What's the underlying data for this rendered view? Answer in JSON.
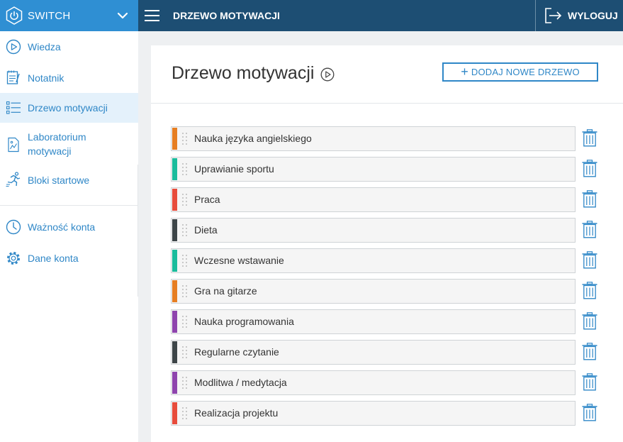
{
  "brand": {
    "name": "SWITCH"
  },
  "header": {
    "title": "DRZEWO MOTYWACJI",
    "logout_label": "WYLOGUJ"
  },
  "sidebar": {
    "items": [
      {
        "label": "Wiedza",
        "icon": "play-circle-icon"
      },
      {
        "label": "Notatnik",
        "icon": "notepad-icon"
      },
      {
        "label": "Drzewo motywacji",
        "icon": "list-icon",
        "active": true
      },
      {
        "label": "Laboratorium motywacji",
        "icon": "image-chart-icon"
      },
      {
        "label": "Bloki startowe",
        "icon": "runner-icon"
      },
      {
        "label": "Ważność konta",
        "icon": "clock-icon"
      },
      {
        "label": "Dane konta",
        "icon": "gear-icon"
      }
    ]
  },
  "main": {
    "title": "Drzewo motywacji",
    "add_button": "DODAJ NOWE DRZEWO",
    "trees": [
      {
        "label": "Nauka języka angielskiego",
        "color": "#e67e22"
      },
      {
        "label": "Uprawianie sportu",
        "color": "#1abc9c"
      },
      {
        "label": "Praca",
        "color": "#e74c3c"
      },
      {
        "label": "Dieta",
        "color": "#3d4548"
      },
      {
        "label": "Wczesne wstawanie",
        "color": "#1abc9c"
      },
      {
        "label": "Gra na gitarze",
        "color": "#e67e22"
      },
      {
        "label": "Nauka programowania",
        "color": "#8e44ad"
      },
      {
        "label": "Regularne czytanie",
        "color": "#3d4548"
      },
      {
        "label": "Modlitwa / medytacja",
        "color": "#8e44ad"
      },
      {
        "label": "Realizacja projektu",
        "color": "#e74c3c"
      }
    ]
  },
  "colors": {
    "accent": "#2f87c7",
    "header": "#1d4e73",
    "brand": "#2f8fd3"
  }
}
